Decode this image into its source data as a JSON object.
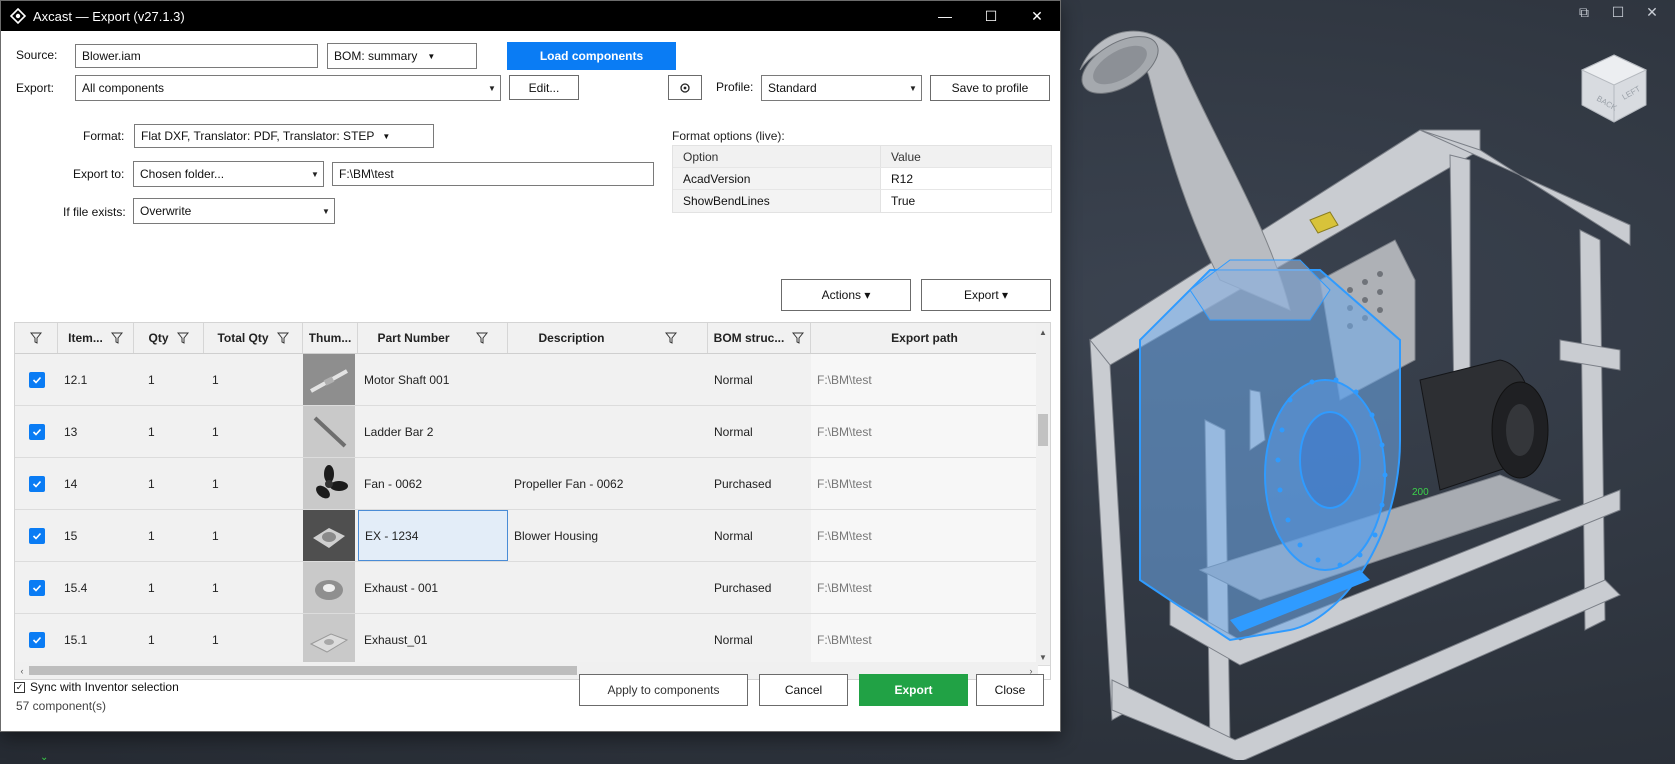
{
  "window": {
    "title": "Axcast — Export (v27.1.3)",
    "minimize": "—",
    "maximize": "☐",
    "close": "✕"
  },
  "source": {
    "label": "Source:",
    "value": "Blower.iam"
  },
  "bom": {
    "value": "BOM:  summary"
  },
  "load_button": "Load components",
  "export_row": {
    "label": "Export:",
    "value": "All components",
    "edit_button": "Edit..."
  },
  "settings_icon": "gear-icon",
  "profile": {
    "label": "Profile:",
    "value": "Standard",
    "save_button": "Save to profile"
  },
  "format": {
    "label": "Format:",
    "value": "Flat DXF,  Translator: PDF,  Translator: STEP"
  },
  "export_to": {
    "label": "Export to:",
    "mode": "Chosen folder...",
    "path": "F:\\BM\\test"
  },
  "if_exists": {
    "label": "If file exists:",
    "value": "Overwrite"
  },
  "format_options": {
    "title": "Format options (live):",
    "headers": {
      "option": "Option",
      "value": "Value"
    },
    "rows": [
      {
        "option": "AcadVersion",
        "value": "R12"
      },
      {
        "option": "ShowBendLines",
        "value": "True"
      }
    ]
  },
  "actions_button": "Actions ▾",
  "export_menu_button": "Export ▾",
  "grid": {
    "headers": {
      "item": "Item...",
      "qty": "Qty",
      "total_qty": "Total Qty",
      "thumb": "Thum...",
      "part_number": "Part Number",
      "description": "Description",
      "bom_structure": "BOM struc...",
      "export_path": "Export path"
    },
    "rows": [
      {
        "item": "12.1",
        "qty": "1",
        "total_qty": "1",
        "thumb": "shaft",
        "part_number": "Motor Shaft 001",
        "description": "",
        "bom": "Normal",
        "path": "F:\\BM\\test"
      },
      {
        "item": "13",
        "qty": "1",
        "total_qty": "1",
        "thumb": "bar",
        "part_number": "Ladder Bar 2",
        "description": "",
        "bom": "Normal",
        "path": "F:\\BM\\test"
      },
      {
        "item": "14",
        "qty": "1",
        "total_qty": "1",
        "thumb": "fan",
        "part_number": "Fan - 0062",
        "description": "Propeller Fan -  0062",
        "bom": "Purchased",
        "path": "F:\\BM\\test"
      },
      {
        "item": "15",
        "qty": "1",
        "total_qty": "1",
        "thumb": "housing",
        "part_number": "EX - 1234",
        "description": "Blower Housing",
        "bom": "Normal",
        "path": "F:\\BM\\test"
      },
      {
        "item": "15.4",
        "qty": "1",
        "total_qty": "1",
        "thumb": "exhaust",
        "part_number": "Exhaust - 001",
        "description": "",
        "bom": "Purchased",
        "path": "F:\\BM\\test"
      },
      {
        "item": "15.1",
        "qty": "1",
        "total_qty": "1",
        "thumb": "plate",
        "part_number": "Exhaust_01",
        "description": "",
        "bom": "Normal",
        "path": "F:\\BM\\test"
      }
    ]
  },
  "sync": {
    "label": "Sync with Inventor selection",
    "checked": true
  },
  "component_count": "57 component(s)",
  "footer_buttons": {
    "apply": "Apply to components",
    "cancel": "Cancel",
    "export": "Export",
    "close": "Close"
  },
  "viewport": {
    "viewcube_face": "BACK",
    "viewcube_side": "LEFT",
    "dimension": "200"
  },
  "colors": {
    "accent": "#0a7cf4",
    "export_green": "#21a245",
    "selection_blue": "#2f9bff"
  }
}
